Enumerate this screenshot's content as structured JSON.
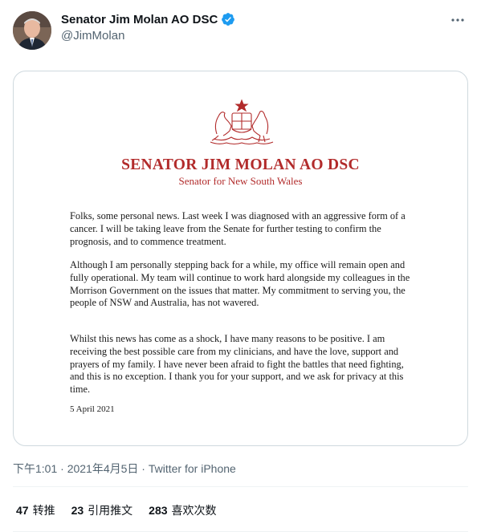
{
  "author": {
    "display_name": "Senator Jim Molan AO DSC",
    "handle": "@JimMolan",
    "verified": true
  },
  "letter": {
    "title": "SENATOR JIM MOLAN AO DSC",
    "subtitle": "Senator for New South Wales",
    "paragraphs": [
      "Folks, some personal news. Last week I was diagnosed with an aggressive form of a cancer. I will be taking leave from the Senate for further testing to confirm the prognosis, and to commence treatment.",
      "Although I am personally stepping back for a while, my office will remain open and fully operational. My team will continue to work hard alongside my colleagues in the Morrison Government on the issues that matter. My commitment to serving you, the people of  NSW and Australia, has not wavered.",
      "Whilst this news has come as a shock, I have many reasons to be positive. I am receiving the best possible care from my clinicians, and have the love, support and prayers of my family. I have never been afraid to fight the battles that need fighting, and this is no exception. I thank you for your support, and we ask for privacy at this time."
    ],
    "date": "5 April 2021"
  },
  "meta": {
    "timestamp": "下午1:01 · 2021年4月5日 · ",
    "source": "Twitter for iPhone"
  },
  "stats": {
    "retweets": {
      "count": "47",
      "label": "转推"
    },
    "quotes": {
      "count": "23",
      "label": "引用推文"
    },
    "likes": {
      "count": "283",
      "label": "喜欢次数"
    }
  },
  "colors": {
    "verified_blue": "#1d9bf0",
    "letterhead_red": "#b22b2b",
    "secondary_text": "#536471"
  }
}
